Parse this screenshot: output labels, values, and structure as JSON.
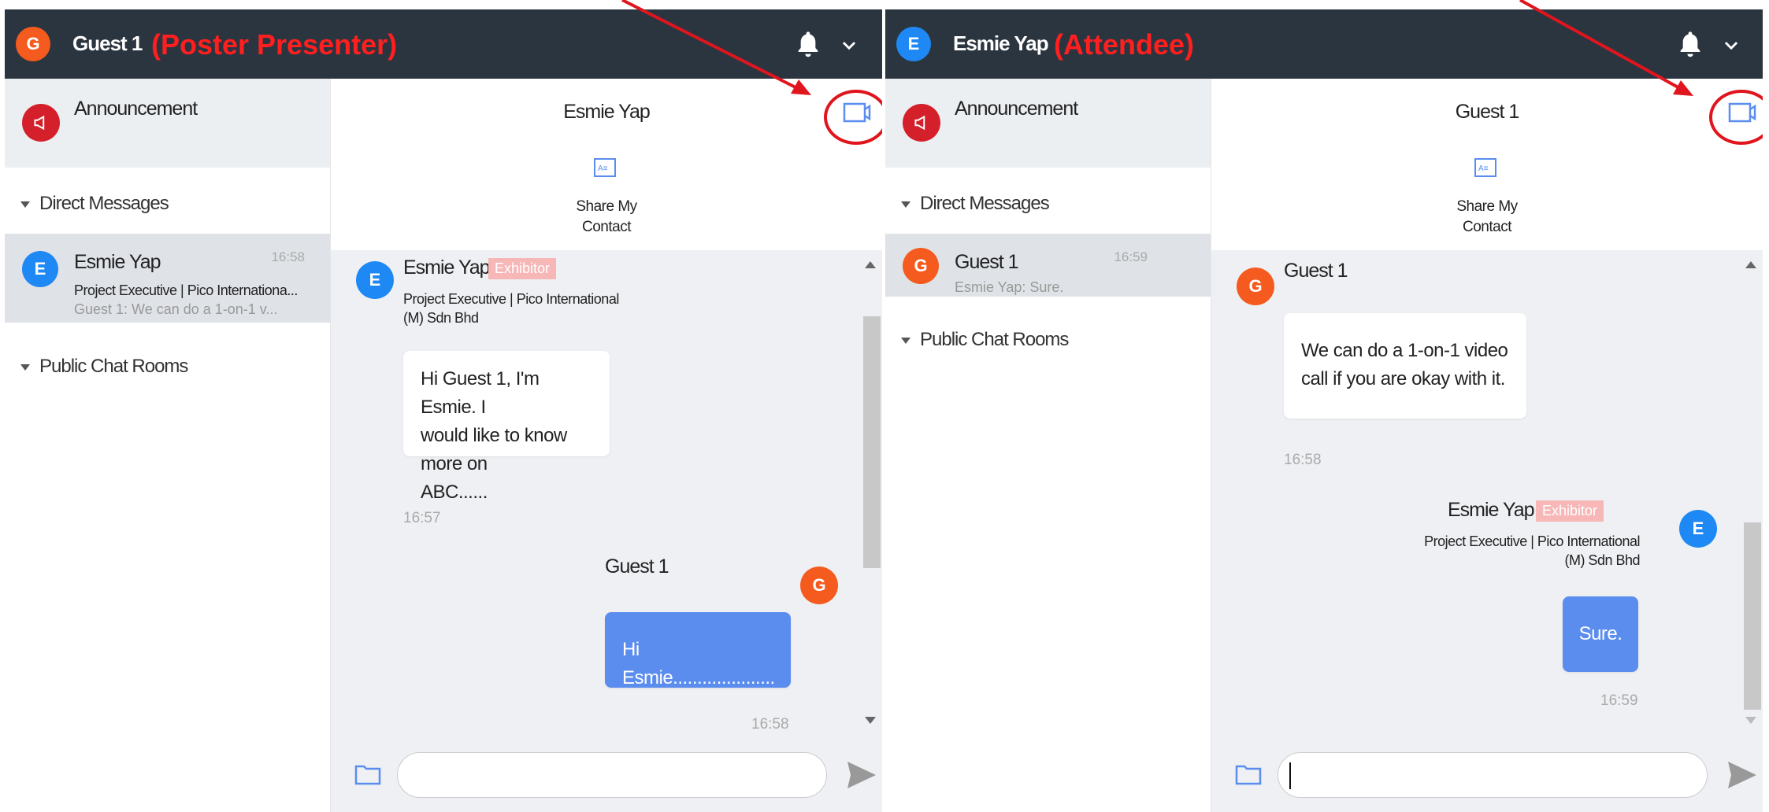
{
  "colors": {
    "header_bg": "#2b3540",
    "accent": "#5b8def",
    "role_label": "#ff1f1f",
    "annotation_red": "#e0151d",
    "avatar_orange": "#f55a1e",
    "avatar_blue": "#1e88f5",
    "announcement_red": "#d3202a"
  },
  "left": {
    "header": {
      "avatar": "G",
      "name": "Guest 1",
      "role": "(Poster Presenter)"
    },
    "sidebar": {
      "announcement": "Announcement",
      "direct_messages": "Direct Messages",
      "dm": {
        "avatar": "E",
        "name": "Esmie Yap",
        "subtitle": "Project Executive | Pico Internationa...",
        "preview": "Guest 1: We can do a 1-on-1 v...",
        "time": "16:58"
      },
      "public_rooms": "Public Chat Rooms"
    },
    "chat": {
      "title": "Esmie Yap",
      "share_line1": "Share My",
      "share_line2": "Contact",
      "messages": [
        {
          "avatar": "E",
          "sender": "Esmie Yap",
          "badge": "Exhibitor",
          "desig1": "Project Executive | Pico International",
          "desig2": "(M) Sdn Bhd",
          "lines": [
            "Hi Guest 1, I'm Esmie. I",
            "would like to know more on",
            "ABC......"
          ],
          "time": "16:57"
        },
        {
          "avatar": "G",
          "sender": "Guest 1",
          "text": "Hi Esmie.....................",
          "time": "16:58"
        }
      ]
    }
  },
  "right": {
    "header": {
      "avatar": "E",
      "name": "Esmie Yap",
      "role": "(Attendee)"
    },
    "sidebar": {
      "announcement": "Announcement",
      "direct_messages": "Direct Messages",
      "dm": {
        "avatar": "G",
        "name": "Guest 1",
        "preview": "Esmie Yap: Sure.",
        "time": "16:59"
      },
      "public_rooms": "Public Chat Rooms"
    },
    "chat": {
      "title": "Guest 1",
      "share_line1": "Share My",
      "share_line2": "Contact",
      "messages": [
        {
          "avatar": "G",
          "sender": "Guest 1",
          "lines": [
            "We can do a 1-on-1 video",
            "call if you are okay with it."
          ],
          "time": "16:58"
        },
        {
          "avatar": "E",
          "sender": "Esmie Yap",
          "badge": "Exhibitor",
          "desig1": "Project Executive | Pico International",
          "desig2": "(M) Sdn Bhd",
          "text": "Sure.",
          "time": "16:59"
        }
      ]
    }
  }
}
